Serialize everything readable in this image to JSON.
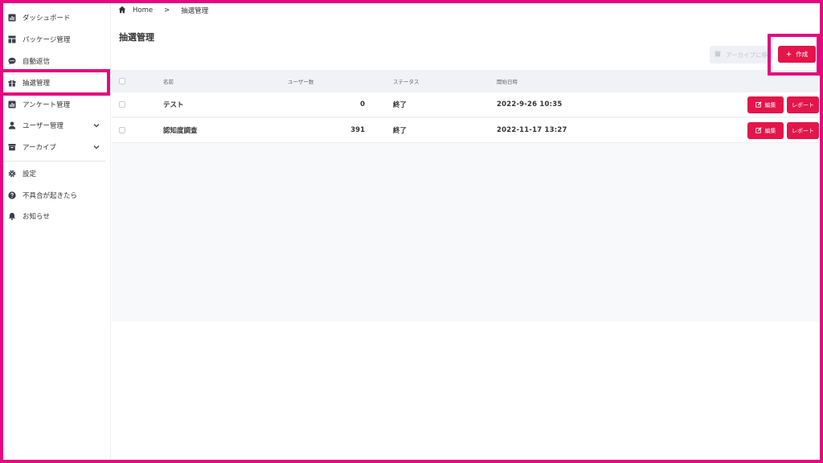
{
  "sidebar": {
    "items": [
      {
        "label": "ダッシュボード",
        "icon": "chart-icon"
      },
      {
        "label": "パッケージ管理",
        "icon": "layout-icon"
      },
      {
        "label": "自動返信",
        "icon": "chat-icon"
      },
      {
        "label": "抽選管理",
        "icon": "gift-icon"
      },
      {
        "label": "アンケート管理",
        "icon": "chart-icon"
      },
      {
        "label": "ユーザー管理",
        "icon": "person-icon"
      },
      {
        "label": "アーカイブ",
        "icon": "archive-icon"
      },
      {
        "label": "設定",
        "icon": "gear-icon"
      },
      {
        "label": "不具合が起きたら",
        "icon": "help-icon"
      },
      {
        "label": "お知らせ",
        "icon": "bell-icon"
      }
    ]
  },
  "breadcrumb": {
    "home": "Home",
    "separator": ">",
    "current": "抽選管理"
  },
  "page": {
    "title": "抽選管理"
  },
  "toolbar": {
    "archive_label": "アーカイブに移動",
    "create_label": "作成",
    "create_icon": "+"
  },
  "table": {
    "headers": {
      "name": "名前",
      "users": "ユーザー数",
      "status": "ステータス",
      "start": "開始日時"
    },
    "rows": [
      {
        "name": "テスト",
        "users": "0",
        "status": "終了",
        "start": "2022-9-26 10:35",
        "edit": "編集",
        "report": "レポート"
      },
      {
        "name": "認知度調査",
        "users": "391",
        "status": "終了",
        "start": "2022-11-17 13:27",
        "edit": "編集",
        "report": "レポート"
      }
    ]
  },
  "colors": {
    "accent": "#e3154a",
    "highlight": "#e5097f"
  }
}
